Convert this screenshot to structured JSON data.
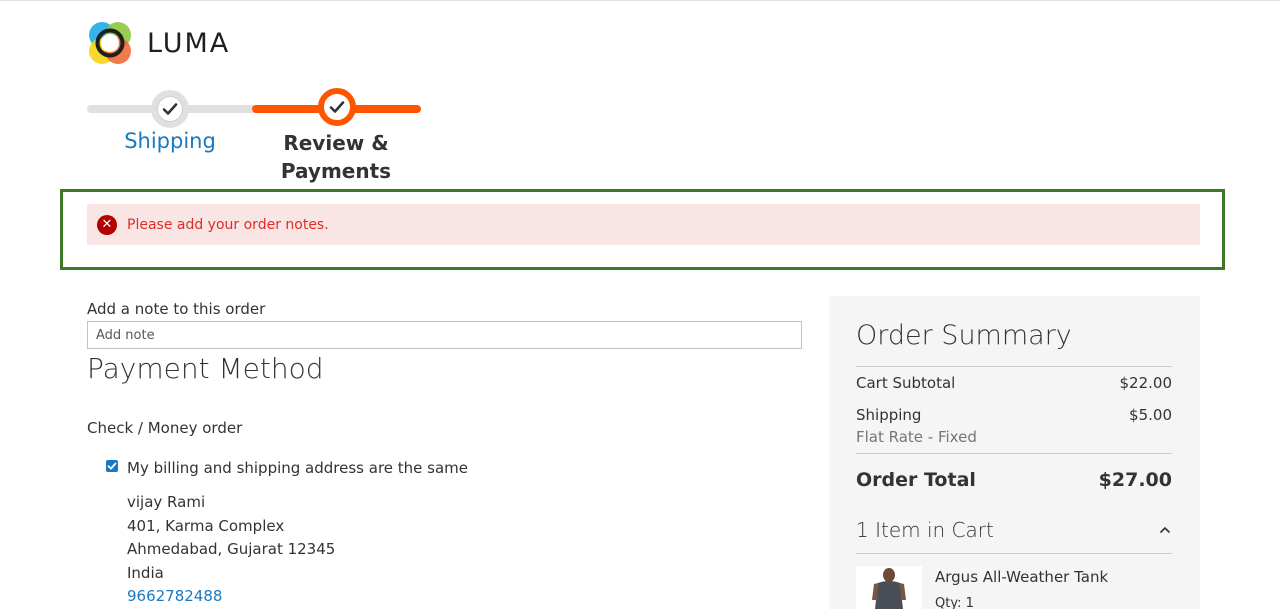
{
  "logo": {
    "text": "LUMA"
  },
  "progress": {
    "steps": [
      {
        "label": "Shipping",
        "state": "completed"
      },
      {
        "label": "Review & Payments",
        "state": "active"
      }
    ]
  },
  "error": {
    "message": "Please add your order notes."
  },
  "order_note": {
    "label": "Add a note to this order",
    "placeholder": "Add note",
    "value": ""
  },
  "payment": {
    "title": "Payment Method",
    "method": "Check / Money order",
    "same_address_label": "My billing and shipping address are the same",
    "same_address_checked": true,
    "address": {
      "name": "vijay Rami",
      "street": "401, Karma Complex",
      "city_line": "Ahmedabad, Gujarat 12345",
      "country": "India",
      "phone": "9662782488"
    }
  },
  "summary": {
    "title": "Order Summary",
    "cart_subtotal_label": "Cart Subtotal",
    "cart_subtotal_value": "$22.00",
    "shipping_label": "Shipping",
    "shipping_value": "$5.00",
    "shipping_method": "Flat Rate - Fixed",
    "total_label": "Order Total",
    "total_value": "$27.00",
    "items_heading": "1 Item in Cart",
    "items": [
      {
        "name": "Argus All-Weather Tank",
        "qty": "Qty: 1"
      }
    ]
  },
  "colors": {
    "accent_orange": "#ff5501",
    "link_blue": "#1979c3",
    "error_red": "#e02b27",
    "error_bg": "#fae5e5",
    "frame_green": "#3e7a26"
  }
}
